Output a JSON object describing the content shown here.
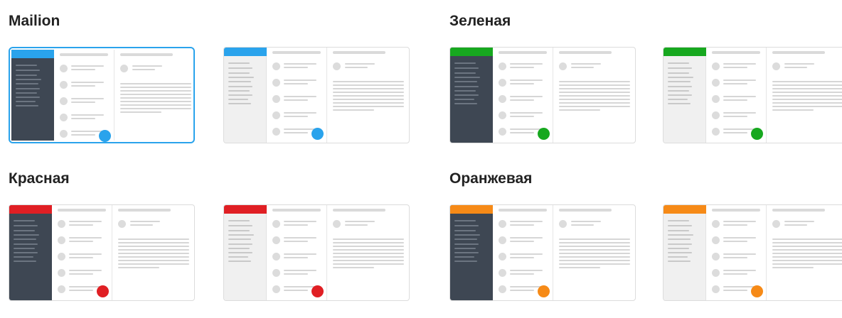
{
  "theme_groups": [
    {
      "title": "Mailion",
      "accent": "#2aa3ec",
      "options": [
        {
          "variant": "dark-sidebar",
          "selected": true
        },
        {
          "variant": "light-sidebar",
          "selected": false
        }
      ]
    },
    {
      "title": "Зеленая",
      "accent": "#17a81f",
      "options": [
        {
          "variant": "dark-sidebar",
          "selected": false
        },
        {
          "variant": "light-sidebar",
          "selected": false
        }
      ]
    },
    {
      "title": "Красная",
      "accent": "#e01f24",
      "options": [
        {
          "variant": "dark-sidebar",
          "selected": false
        },
        {
          "variant": "light-sidebar",
          "selected": false
        }
      ]
    },
    {
      "title": "Оранжевая",
      "accent": "#f68a17",
      "options": [
        {
          "variant": "dark-sidebar",
          "selected": false
        },
        {
          "variant": "light-sidebar",
          "selected": false
        }
      ]
    }
  ],
  "colors": {
    "dark_sidebar": "#3e4753",
    "light_sidebar": "#f0f0f0",
    "selection_border": "#2aa3ec"
  }
}
